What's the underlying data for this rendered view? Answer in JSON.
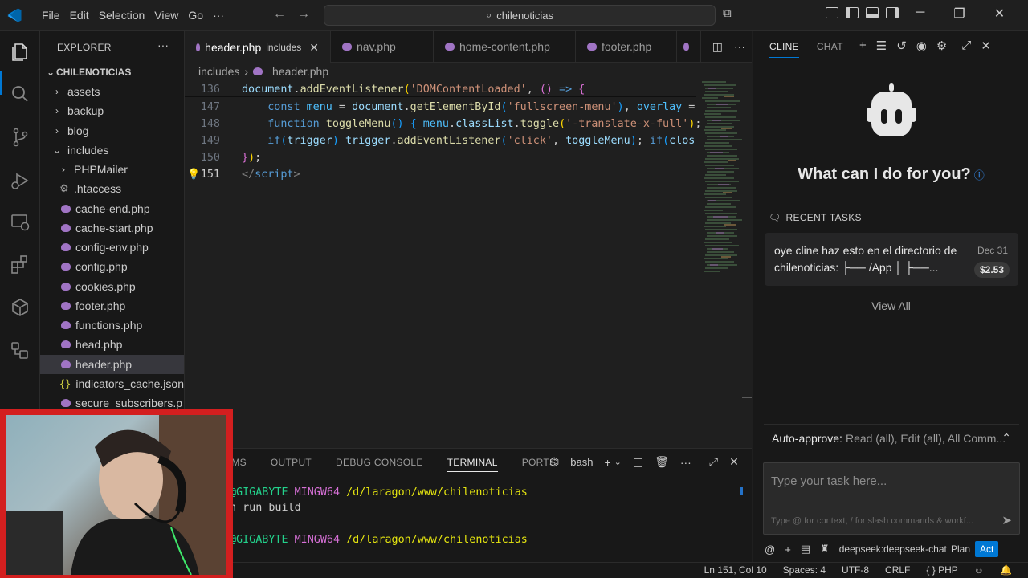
{
  "titlebar": {
    "menu": [
      "File",
      "Edit",
      "Selection",
      "View",
      "Go",
      "···"
    ],
    "search": "chilenoticias"
  },
  "explorer": {
    "title": "EXPLORER",
    "root": "CHILENOTICIAS",
    "items": [
      {
        "label": "assets",
        "type": "folder",
        "open": false,
        "depth": 1
      },
      {
        "label": "backup",
        "type": "folder",
        "open": false,
        "depth": 1
      },
      {
        "label": "blog",
        "type": "folder",
        "open": false,
        "depth": 1
      },
      {
        "label": "includes",
        "type": "folder",
        "open": true,
        "depth": 1
      },
      {
        "label": "PHPMailer",
        "type": "folder",
        "open": false,
        "depth": 2
      },
      {
        "label": ".htaccess",
        "type": "config",
        "depth": 2
      },
      {
        "label": "cache-end.php",
        "type": "php",
        "depth": 2
      },
      {
        "label": "cache-start.php",
        "type": "php",
        "depth": 2
      },
      {
        "label": "config-env.php",
        "type": "php",
        "depth": 2
      },
      {
        "label": "config.php",
        "type": "php",
        "depth": 2
      },
      {
        "label": "cookies.php",
        "type": "php",
        "depth": 2
      },
      {
        "label": "footer.php",
        "type": "php",
        "depth": 2
      },
      {
        "label": "functions.php",
        "type": "php",
        "depth": 2
      },
      {
        "label": "head.php",
        "type": "php",
        "depth": 2
      },
      {
        "label": "header.php",
        "type": "php",
        "depth": 2,
        "selected": true
      },
      {
        "label": "indicators_cache.json",
        "type": "json",
        "depth": 2
      },
      {
        "label": "secure_subscribers.p",
        "type": "php",
        "depth": 2
      }
    ]
  },
  "tabs": [
    {
      "label": "header.php",
      "desc": "includes",
      "active": true
    },
    {
      "label": "nav.php"
    },
    {
      "label": "home-content.php"
    },
    {
      "label": "footer.php"
    }
  ],
  "breadcrumb": [
    "includes",
    "header.php"
  ],
  "code": {
    "line_136_num": "136",
    "line_147_num": "147",
    "line_148_num": "148",
    "line_149_num": "149",
    "line_150_num": "150",
    "line_151_num": "151"
  },
  "panel": {
    "tabs": [
      "EMS",
      "OUTPUT",
      "DEBUG CONSOLE",
      "TERMINAL",
      "PORTS"
    ],
    "shell": "bash",
    "term_line1_host": "@GIGABYTE",
    "term_line1_env": "MINGW64",
    "term_line1_path": "/d/laragon/www/chilenoticias",
    "term_line2": "n run build",
    "term_line3_host": "@GIGABYTE",
    "term_line3_env": "MINGW64",
    "term_line3_path": "/d/laragon/www/chilenoticias"
  },
  "status": {
    "position": "Ln 151, Col 10",
    "spaces": "Spaces: 4",
    "encoding": "UTF-8",
    "eol": "CRLF",
    "language": "PHP",
    "braces": "{ }"
  },
  "cline": {
    "tab_cline": "CLINE",
    "tab_chat": "CHAT",
    "greeting": "What can I do for you?",
    "recent_title": "RECENT TASKS",
    "task_text": "oye cline haz esto en el directorio de chilenoticias: ├── /App │ ├──...",
    "task_date": "Dec 31",
    "task_cost": "$2.53",
    "view_all": "View All",
    "auto_approve_label": "Auto-approve:",
    "auto_approve_value": "Read (all), Edit (all), All Comm...",
    "input_placeholder": "Type your task here...",
    "input_hint": "Type @ for context, / for slash commands & workf...",
    "model": "deepseek:deepseek-chat",
    "plan": "Plan",
    "act": "Act"
  },
  "colors": {
    "accent": "#0078d4",
    "php_icon": "#a074c4",
    "webcam_border": "#d31f1f"
  }
}
